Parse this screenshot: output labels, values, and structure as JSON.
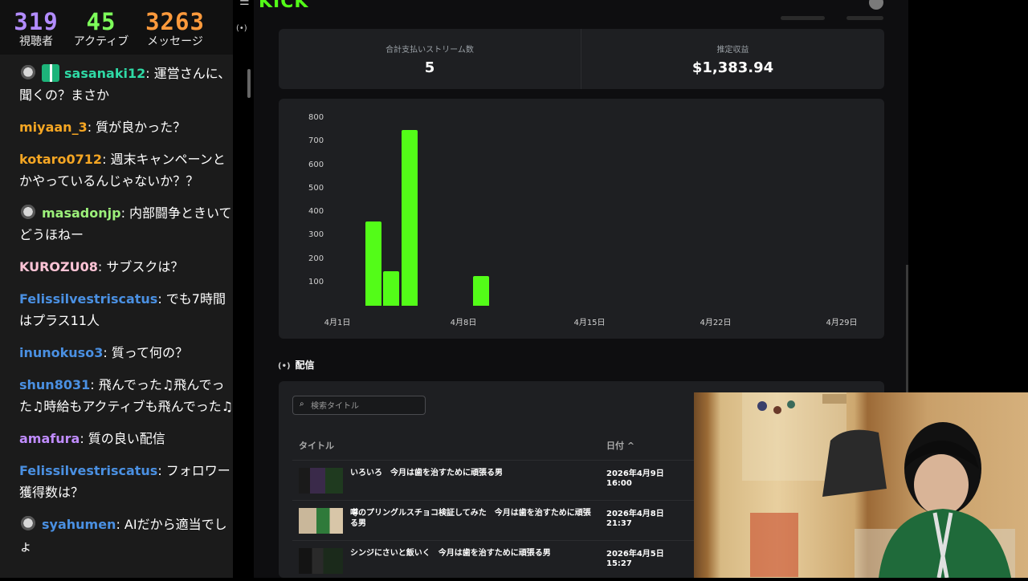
{
  "stats": [
    {
      "value": "319",
      "label": "視聴者",
      "color": "#b28cff"
    },
    {
      "value": "45",
      "label": "アクティブ",
      "color": "#7dff5a"
    },
    {
      "value": "3263",
      "label": "メッセージ",
      "color": "#ff9a3c"
    }
  ],
  "chat": [
    {
      "user": "sasanaki12",
      "text": ": 運営さんに、聞くの？まさか",
      "color": "#2fd9a5",
      "badges": [
        "cat-badge",
        "gift-badge"
      ]
    },
    {
      "user": "miyaan_3",
      "text": ": 質が良かった？",
      "color": "#f5a623",
      "badges": []
    },
    {
      "user": "kotaro0712",
      "text": ": 週末キャンペーンとかやっているんじゃないか？？",
      "color": "#f5a623",
      "badges": []
    },
    {
      "user": "masadonjp",
      "text": ": 内部闘争ときいてどうほねー",
      "color": "#9cf07a",
      "badges": [
        "cat-badge"
      ]
    },
    {
      "user": "KUROZU08",
      "text": ": サブスクは？",
      "color": "#ffc4d6",
      "badges": []
    },
    {
      "user": "Felissilvestriscatus",
      "text": ": でも7時間はプラス11人",
      "color": "#4a90e2",
      "badges": []
    },
    {
      "user": "inunokuso3",
      "text": ": 質って何の？",
      "color": "#4a90e2",
      "badges": []
    },
    {
      "user": "shun8031",
      "text": ": 飛んでった♫飛んでった♫時給もアクティブも飛んでった♫",
      "color": "#4a90e2",
      "badges": []
    },
    {
      "user": "amafura",
      "text": ": 質の良い配信",
      "color": "#c08cff",
      "badges": []
    },
    {
      "user": "Felissilvestriscatus",
      "text": ": フォロワー獲得数は？",
      "color": "#4a90e2",
      "badges": []
    },
    {
      "user": "syahumen",
      "text": ": AIだから適当でしょ",
      "color": "#4a90e2",
      "badges": [
        "cat-badge"
      ]
    }
  ],
  "brand": {
    "logo": "KICK",
    "accent": "#53fc18"
  },
  "kpis": {
    "streams_label": "合計支払いストリーム数",
    "streams_value": "5",
    "earnings_label": "推定収益",
    "earnings_value": "$1,383.94"
  },
  "chart_data": {
    "type": "bar",
    "x": [
      "4月3日",
      "4月4日",
      "4月5日",
      "4月9日"
    ],
    "values": [
      360,
      148,
      748,
      128
    ],
    "xticks": [
      "4月1日",
      "4月8日",
      "4月15日",
      "4月22日",
      "4月29日"
    ],
    "yticks": [
      100,
      200,
      300,
      400,
      500,
      600,
      700,
      800
    ],
    "ylim": [
      0,
      800
    ],
    "color": "#53fc18",
    "grid": false
  },
  "streams_section": {
    "title": "配信",
    "search_placeholder": "検索タイトル",
    "col_title": "タイトル",
    "col_date": "日付 ^",
    "rows": [
      {
        "title": "いろいろ　今月は歯を治すために頑張る男",
        "date": "2026年4月9日 16:00"
      },
      {
        "title": "噂のプリングルスチョコ検証してみた　今月は歯を治すために頑張る男",
        "date": "2026年4月8日 21:37"
      },
      {
        "title": "シンジにさいと飯いく　今月は歯を治すために頑張る男",
        "date": "2026年4月5日 15:27"
      }
    ]
  }
}
